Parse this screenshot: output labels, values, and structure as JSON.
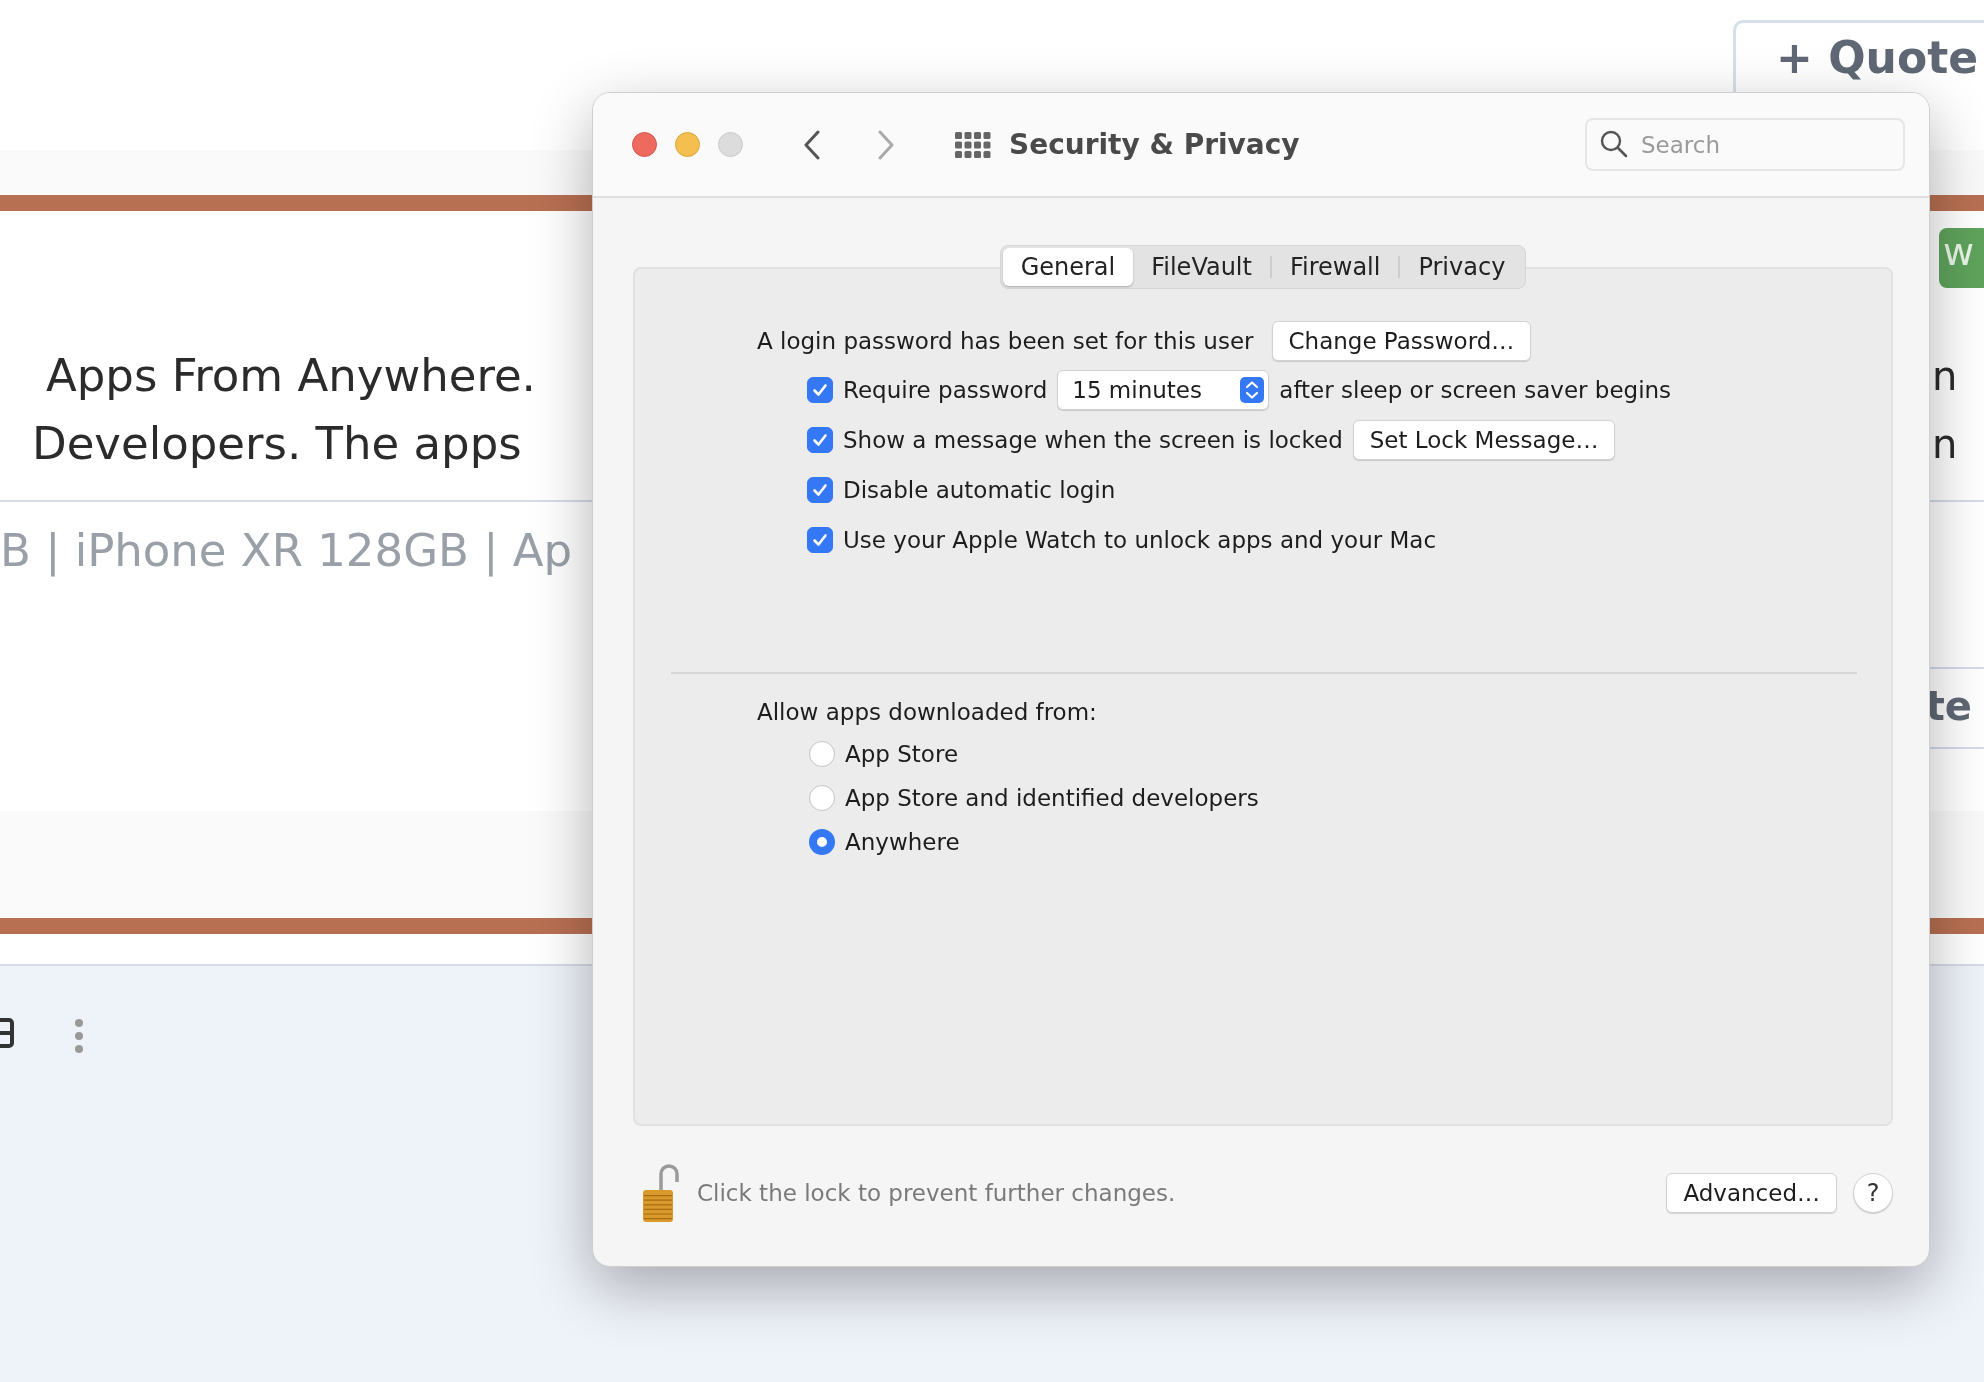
{
  "background_page": {
    "quote_button": "+ Quote",
    "badge": "w",
    "lines": [
      "Apps From Anywhere.",
      "Developers. The apps"
    ],
    "right_fragments": [
      "n",
      "n"
    ],
    "tags_line": "B | iPhone XR 128GB | Ap",
    "heading_fragment": "te"
  },
  "window": {
    "title": "Security & Privacy",
    "search": {
      "placeholder": "Search"
    }
  },
  "tabs": [
    {
      "label": "General",
      "selected": true
    },
    {
      "label": "FileVault",
      "selected": false
    },
    {
      "label": "Firewall",
      "selected": false
    },
    {
      "label": "Privacy",
      "selected": false
    }
  ],
  "password": {
    "status": "A login password has been set for this user",
    "button": "Change Password…"
  },
  "options": [
    {
      "kind": "popup",
      "checked": true,
      "label": "Require password",
      "value": "15 minutes",
      "suffix": "after sleep or screen saver begins"
    },
    {
      "kind": "button",
      "checked": true,
      "label": "Show a message when the screen is locked",
      "button": "Set Lock Message…"
    },
    {
      "kind": "plain",
      "checked": true,
      "label": "Disable automatic login"
    },
    {
      "kind": "plain",
      "checked": true,
      "label": "Use your Apple Watch to unlock apps and your Mac"
    }
  ],
  "downloads": {
    "label": "Allow apps downloaded from:",
    "choices": [
      {
        "label": "App Store",
        "selected": false
      },
      {
        "label": "App Store and identified developers",
        "selected": false
      },
      {
        "label": "Anywhere",
        "selected": true
      }
    ]
  },
  "footer": {
    "locked": false,
    "lock_text": "Click the lock to prevent further changes.",
    "advanced_button": "Advanced…",
    "help_button": "?"
  }
}
